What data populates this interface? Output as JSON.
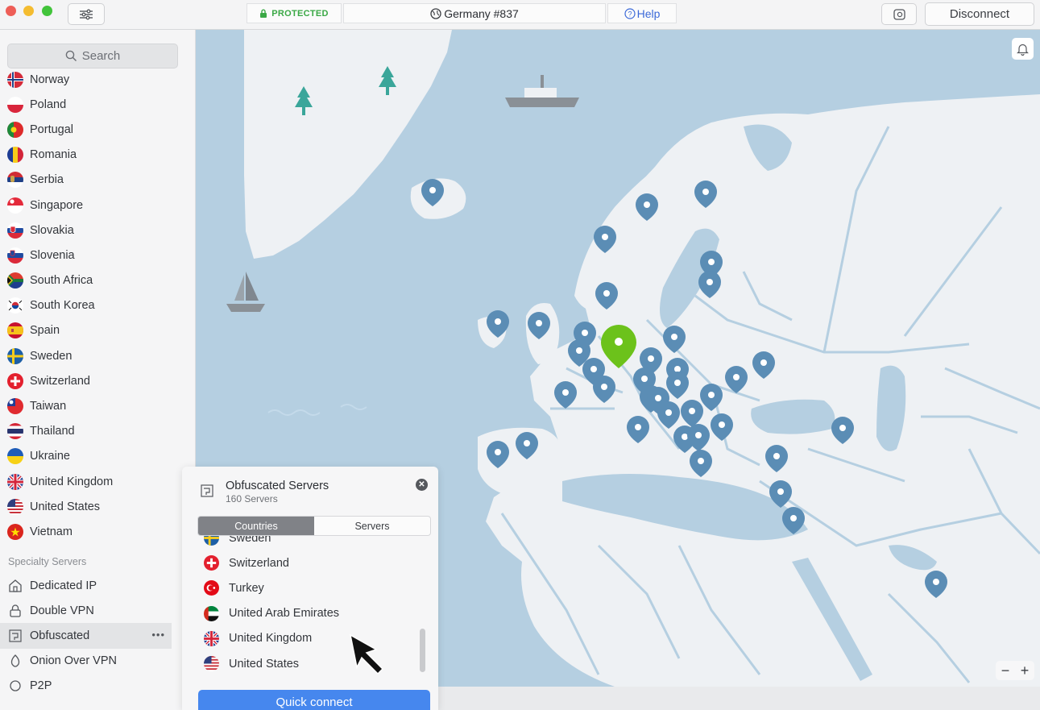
{
  "titlebar": {
    "status": "PROTECTED",
    "location": "Germany #837",
    "help_label": "Help",
    "disconnect_label": "Disconnect"
  },
  "sidebar": {
    "search_placeholder": "Search",
    "countries": [
      {
        "name": "Norway",
        "flag": "norway-flag-icon"
      },
      {
        "name": "Poland",
        "flag": "poland-flag-icon"
      },
      {
        "name": "Portugal",
        "flag": "portugal-flag-icon"
      },
      {
        "name": "Romania",
        "flag": "romania-flag-icon"
      },
      {
        "name": "Serbia",
        "flag": "serbia-flag-icon"
      },
      {
        "name": "Singapore",
        "flag": "singapore-flag-icon"
      },
      {
        "name": "Slovakia",
        "flag": "slovakia-flag-icon"
      },
      {
        "name": "Slovenia",
        "flag": "slovenia-flag-icon"
      },
      {
        "name": "South Africa",
        "flag": "south-africa-flag-icon"
      },
      {
        "name": "South Korea",
        "flag": "south-korea-flag-icon"
      },
      {
        "name": "Spain",
        "flag": "spain-flag-icon"
      },
      {
        "name": "Sweden",
        "flag": "sweden-flag-icon"
      },
      {
        "name": "Switzerland",
        "flag": "switzerland-flag-icon"
      },
      {
        "name": "Taiwan",
        "flag": "taiwan-flag-icon"
      },
      {
        "name": "Thailand",
        "flag": "thailand-flag-icon"
      },
      {
        "name": "Ukraine",
        "flag": "ukraine-flag-icon"
      },
      {
        "name": "United Kingdom",
        "flag": "united-kingdom-flag-icon"
      },
      {
        "name": "United States",
        "flag": "united-states-flag-icon"
      },
      {
        "name": "Vietnam",
        "flag": "vietnam-flag-icon"
      }
    ],
    "specialty_label": "Specialty Servers",
    "specialty": [
      {
        "name": "Dedicated IP",
        "icon": "house-icon"
      },
      {
        "name": "Double VPN",
        "icon": "lock-icon"
      },
      {
        "name": "Obfuscated",
        "icon": "obfuscated-icon",
        "active": true
      },
      {
        "name": "Onion Over VPN",
        "icon": "onion-icon"
      },
      {
        "name": "P2P",
        "icon": "p2p-icon"
      }
    ]
  },
  "panel": {
    "title": "Obfuscated Servers",
    "subtitle": "160 Servers",
    "tabs": [
      {
        "label": "Countries",
        "selected": true
      },
      {
        "label": "Servers",
        "selected": false
      }
    ],
    "countries": [
      {
        "name": "Sweden",
        "flag": "sweden-flag-icon"
      },
      {
        "name": "Switzerland",
        "flag": "switzerland-flag-icon"
      },
      {
        "name": "Turkey",
        "flag": "turkey-flag-icon"
      },
      {
        "name": "United Arab Emirates",
        "flag": "uae-flag-icon"
      },
      {
        "name": "United Kingdom",
        "flag": "united-kingdom-flag-icon"
      },
      {
        "name": "United States",
        "flag": "united-states-flag-icon"
      }
    ],
    "quick_connect_label": "Quick connect"
  },
  "map": {
    "zoom_out": "−",
    "zoom_in": "+"
  },
  "colors": {
    "protected_green": "#3aa845",
    "accent_blue": "#4687ee",
    "pin_blue": "#5b8db5",
    "pin_active_green": "#6cc21b",
    "sea": "#b5cfe1",
    "land": "#eef1f4"
  }
}
